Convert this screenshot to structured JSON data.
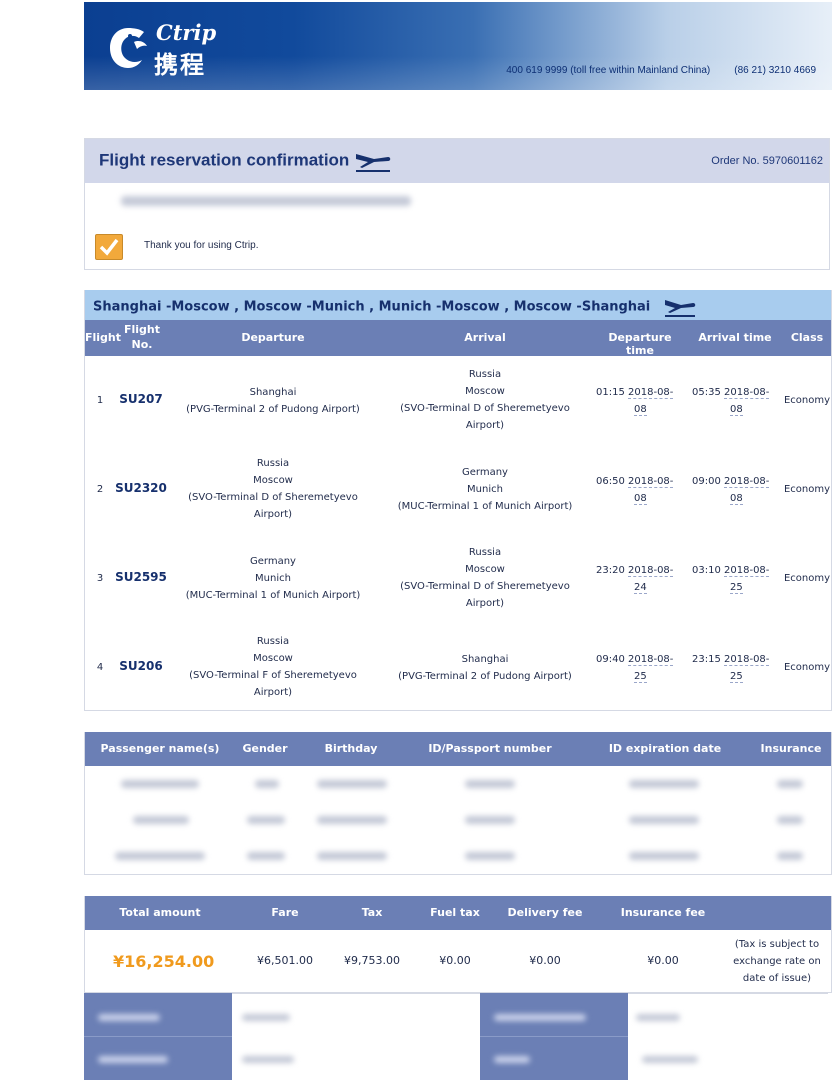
{
  "header": {
    "logo_en": "Ctrip",
    "logo_zh": "携程",
    "phone_cn": "400 619 9999 (toll free within Mainland China)",
    "phone_intl": "(86 21) 3210 4669"
  },
  "confirmation": {
    "title": "Flight reservation confirmation",
    "order_label": "Order No. 5970601162",
    "thanks": "Thank you for using Ctrip."
  },
  "route": {
    "summary": "Shanghai -Moscow , Moscow -Munich , Munich -Moscow , Moscow -Shanghai"
  },
  "flight_table": {
    "headers": [
      "Flight",
      "Flight No.",
      "Departure",
      "Arrival",
      "Departure time",
      "Arrival time",
      "Class"
    ],
    "rows": [
      {
        "num": "1",
        "flight_no": "SU207",
        "dep1": "Shanghai",
        "dep2": "(PVG-Terminal 2 of Pudong Airport)",
        "dep3": "",
        "dep4": "",
        "arr1": "Russia",
        "arr2": "Moscow",
        "arr3": "(SVO-Terminal D of Sheremetyevo",
        "arr4": "Airport)",
        "dep_time": "01:15",
        "dep_date1": "2018-08-",
        "dep_date2": "08",
        "arr_time": "05:35",
        "arr_date1": "2018-08-",
        "arr_date2": "08",
        "class": "Economy"
      },
      {
        "num": "2",
        "flight_no": "SU2320",
        "dep1": "Russia",
        "dep2": "Moscow",
        "dep3": "(SVO-Terminal D of Sheremetyevo",
        "dep4": "Airport)",
        "arr1": "Germany",
        "arr2": "Munich",
        "arr3": "(MUC-Terminal 1 of Munich Airport)",
        "arr4": "",
        "dep_time": "06:50",
        "dep_date1": "2018-08-",
        "dep_date2": "08",
        "arr_time": "09:00",
        "arr_date1": "2018-08-",
        "arr_date2": "08",
        "class": "Economy"
      },
      {
        "num": "3",
        "flight_no": "SU2595",
        "dep1": "Germany",
        "dep2": "Munich",
        "dep3": "(MUC-Terminal 1 of Munich Airport)",
        "dep4": "",
        "arr1": "Russia",
        "arr2": "Moscow",
        "arr3": "(SVO-Terminal D of Sheremetyevo",
        "arr4": "Airport)",
        "dep_time": "23:20",
        "dep_date1": "2018-08-",
        "dep_date2": "24",
        "arr_time": "03:10",
        "arr_date1": "2018-08-",
        "arr_date2": "25",
        "class": "Economy"
      },
      {
        "num": "4",
        "flight_no": "SU206",
        "dep1": "Russia",
        "dep2": "Moscow",
        "dep3": "(SVO-Terminal F of Sheremetyevo",
        "dep4": "Airport)",
        "arr1": "Shanghai",
        "arr2": "(PVG-Terminal 2 of Pudong Airport)",
        "arr3": "",
        "arr4": "",
        "dep_time": "09:40",
        "dep_date1": "2018-08-",
        "dep_date2": "25",
        "arr_time": "23:15",
        "arr_date1": "2018-08-",
        "arr_date2": "25",
        "class": "Economy"
      }
    ]
  },
  "passenger_table": {
    "headers": [
      "Passenger name(s)",
      "Gender",
      "Birthday",
      "ID/Passport number",
      "ID expiration date",
      "Insurance"
    ]
  },
  "total_table": {
    "headers": [
      "Total amount",
      "Fare",
      "Tax",
      "Fuel tax",
      "Delivery fee",
      "Insurance fee"
    ],
    "total": "¥16,254.00",
    "fare": "¥6,501.00",
    "tax": "¥9,753.00",
    "fuel_tax": "¥0.00",
    "delivery_fee": "¥0.00",
    "insurance_fee": "¥0.00",
    "note": "(Tax is subject to exchange rate on date of issue)"
  },
  "colors": {
    "banner_dark": "#0b3f91",
    "header_row": "#6b7fb5",
    "route_bar": "#a8ccee",
    "confirm_head": "#d2d7ea",
    "total_amount": "#f09a1d",
    "check_box": "#f2a93b"
  }
}
